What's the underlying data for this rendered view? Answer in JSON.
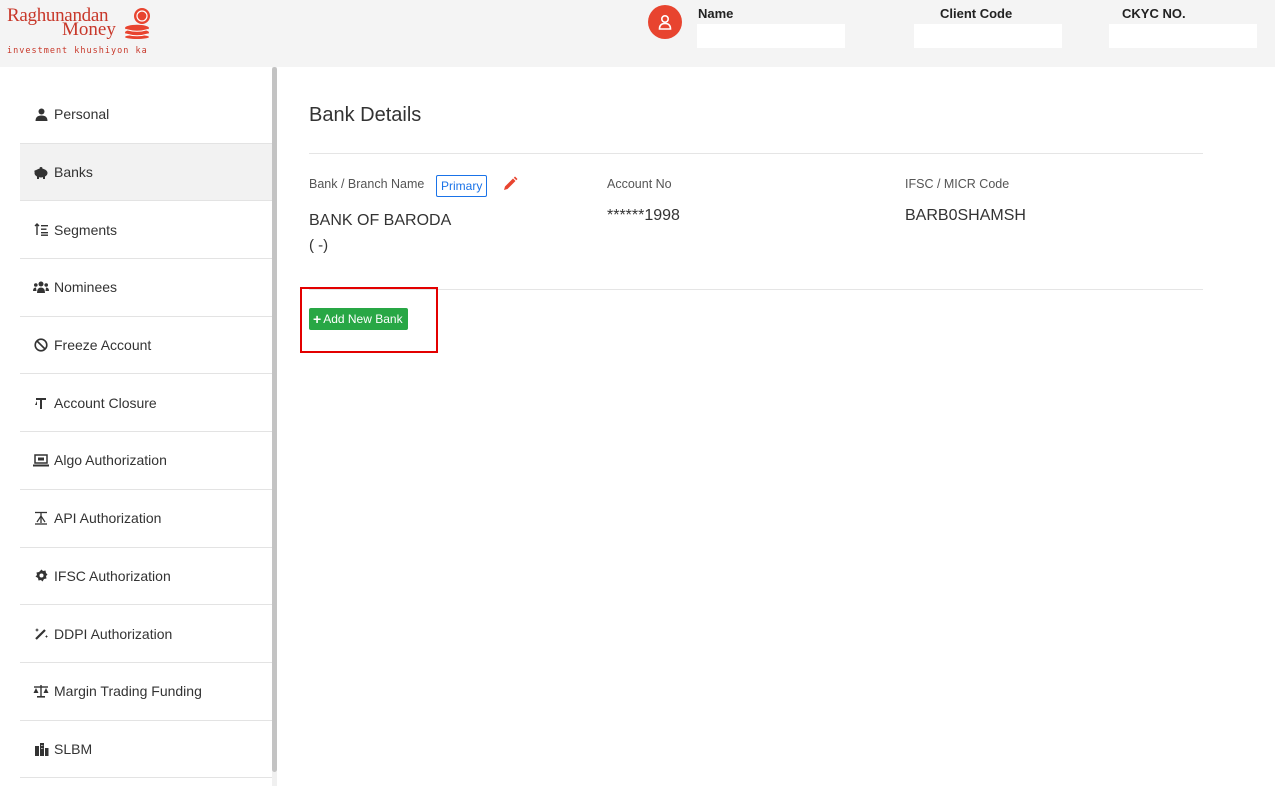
{
  "brand": {
    "line1": "Raghunandan",
    "line2": "Money",
    "tagline": "investment khushiyon ka",
    "color": "#c8382a"
  },
  "header": {
    "name_label": "Name",
    "client_code_label": "Client Code",
    "ckyc_label": "CKYC NO.",
    "name_value": "",
    "client_code_value": "",
    "ckyc_value": "",
    "avatar_icon": "user-icon",
    "avatar_color": "#e8442f"
  },
  "sidebar": {
    "items": [
      {
        "label": "Personal",
        "icon": "user-icon"
      },
      {
        "label": "Banks",
        "icon": "piggy-bank-icon",
        "active": true
      },
      {
        "label": "Segments",
        "icon": "sort-icon"
      },
      {
        "label": "Nominees",
        "icon": "users-icon"
      },
      {
        "label": "Freeze Account",
        "icon": "ban-icon"
      },
      {
        "label": "Account Closure",
        "icon": "closure-icon"
      },
      {
        "label": "Algo Authorization",
        "icon": "laptop-icon"
      },
      {
        "label": "API Authorization",
        "icon": "api-icon"
      },
      {
        "label": "IFSC Authorization",
        "icon": "gear-icon"
      },
      {
        "label": "DDPI Authorization",
        "icon": "wand-icon"
      },
      {
        "label": "Margin Trading Funding",
        "icon": "scale-icon"
      },
      {
        "label": "SLBM",
        "icon": "building-icon"
      }
    ]
  },
  "main": {
    "title": "Bank Details",
    "columns": {
      "bank_label": "Bank / Branch Name",
      "account_label": "Account No",
      "ifsc_label": "IFSC / MICR Code"
    },
    "bank": {
      "badge": "Primary",
      "name": "BANK OF BARODA",
      "branch": "( -)",
      "account_no": "******1998",
      "ifsc": "BARB0SHAMSH"
    },
    "add_button": "Add New Bank",
    "accent_color": "#28a745",
    "highlight_color": "#e30000"
  }
}
